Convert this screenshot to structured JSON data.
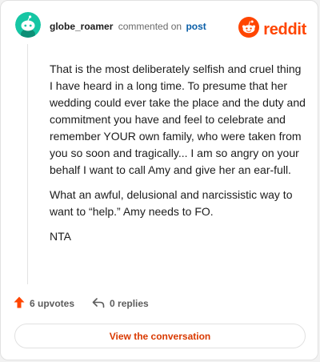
{
  "comment": {
    "username": "globe_roamer",
    "action_text": "commented on",
    "post_link": "post",
    "paragraphs": [
      "That is the most deliberately selfish and cruel thing I have heard in a long time. To presume that her wedding could ever take the place and the duty and commitment you have and feel to celebrate and remember YOUR own family, who were taken from you so soon and tragically... I am so angry on your behalf I want to call Amy and give her an ear-full.",
      "What an awful, delusional and narcissistic way to want to “help.” Amy needs to FO.",
      "NTA"
    ]
  },
  "brand": {
    "wordmark": "reddit",
    "icon": "reddit-snoo-icon",
    "color": "#ff4500"
  },
  "avatar": {
    "icon": "snoo-avatar-icon",
    "color": "#16c6a4"
  },
  "footer": {
    "upvotes_label": "6 upvotes",
    "replies_label": "0 replies",
    "upvote_icon": "upvote-arrow-icon",
    "reply_icon": "reply-arrow-icon",
    "upvote_color": "#ff4500"
  },
  "cta": {
    "label": "View the conversation",
    "color": "#d93900"
  }
}
